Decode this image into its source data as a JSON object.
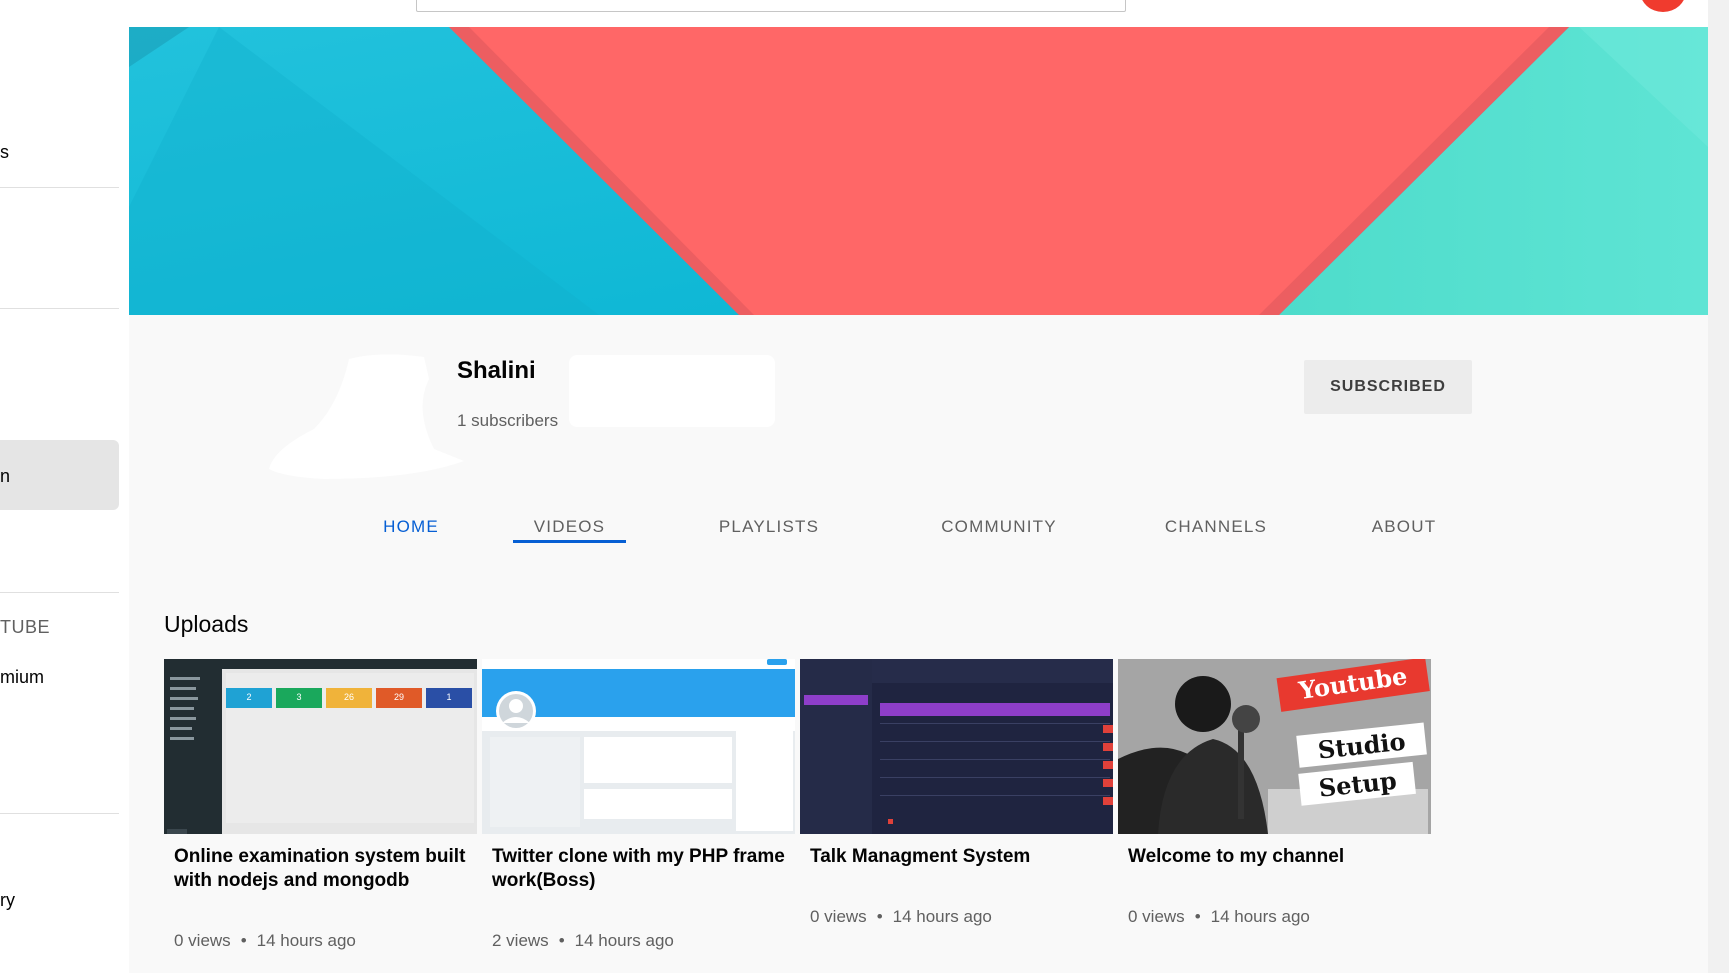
{
  "sidebar": {
    "fragments": [
      {
        "text": "s"
      },
      {
        "text": "n"
      },
      {
        "text": "TUBE"
      },
      {
        "text": "mium"
      },
      {
        "text": "ry"
      }
    ]
  },
  "channel": {
    "name": "Shalini",
    "subscribers": "1 subscribers",
    "subscribe_label": "SUBSCRIBED"
  },
  "tabs": [
    {
      "label": "HOME"
    },
    {
      "label": "VIDEOS"
    },
    {
      "label": "PLAYLISTS"
    },
    {
      "label": "COMMUNITY"
    },
    {
      "label": "CHANNELS"
    },
    {
      "label": "ABOUT"
    }
  ],
  "section": {
    "title": "Uploads"
  },
  "videos": [
    {
      "title": "Online examination system built with nodejs and mongodb",
      "views": "0 views",
      "age": "14 hours ago"
    },
    {
      "title": "Twitter clone with my PHP framework(Boss)",
      "views": "2 views",
      "age": "14 hours ago"
    },
    {
      "title": "Talk Managment System",
      "views": "0 views",
      "age": "14 hours ago"
    },
    {
      "title": "Welcome to my channel",
      "views": "0 views",
      "age": "14 hours ago"
    }
  ],
  "thumbnails": {
    "exam_tiles": [
      "2",
      "3",
      "26",
      "29",
      "1"
    ],
    "exam_tile_colors": [
      "#1fa2d4",
      "#1aa85c",
      "#f0b33a",
      "#e05a28",
      "#2a4fa6"
    ],
    "youtube_badge": "Youtube",
    "studio_text": "Studio",
    "setup_text": "Setup"
  },
  "colors": {
    "accent": "#065fd4",
    "banner_cyan": "#0fbad6",
    "banner_red": "#ff6666",
    "banner_teal": "#55e0cf"
  }
}
